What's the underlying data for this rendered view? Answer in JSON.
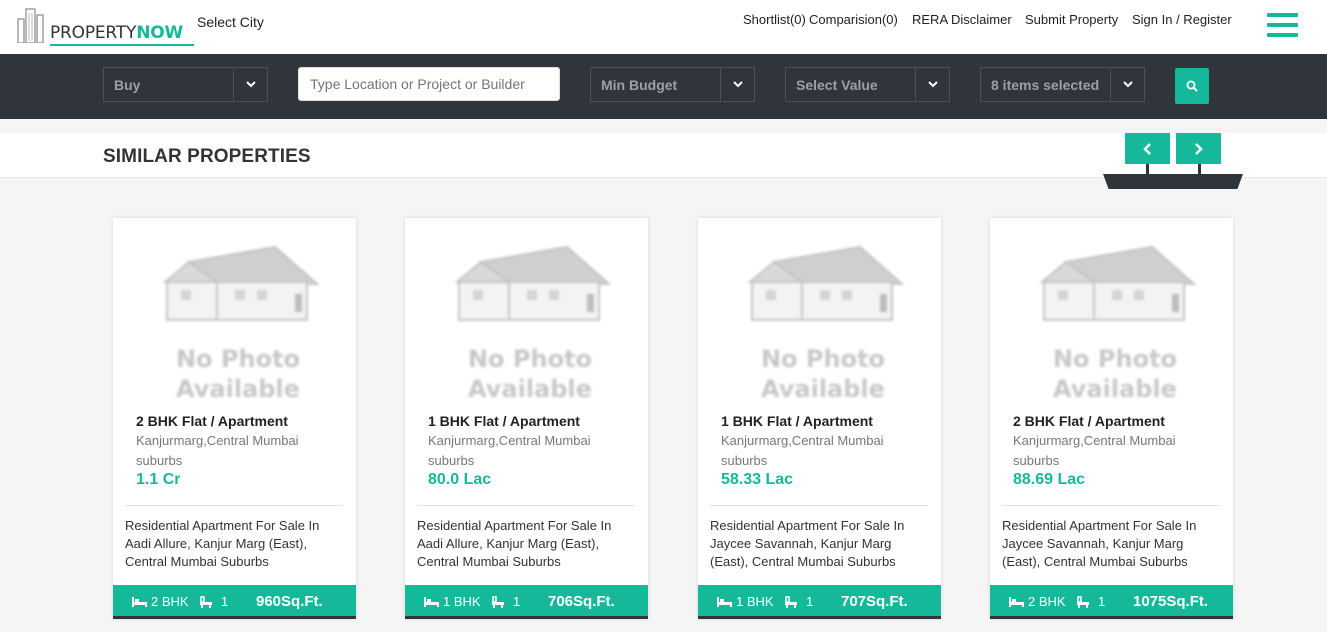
{
  "header": {
    "logo": {
      "part1": "PROPERTY",
      "part2": "NOW"
    },
    "select_city": "Select City",
    "nav": {
      "shortlist": "Shortlist(0)",
      "comparision": "Comparision(0)",
      "rera": "RERA Disclaimer",
      "submit": "Submit Property",
      "signin": "Sign In / Register"
    }
  },
  "search": {
    "type_value": "Buy",
    "location_placeholder": "Type Location or Project or Builder",
    "min_budget": "Min Budget",
    "max_value": "Select Value",
    "property_types": "8 items selected"
  },
  "section": {
    "title": "SIMILAR PROPERTIES"
  },
  "colors": {
    "accent": "#15b99a",
    "dark": "#2f353a"
  },
  "properties": [
    {
      "no_photo": "No Photo Available",
      "type": "2 BHK Flat / Apartment",
      "location": "Kanjurmarg,Central Mumbai suburbs",
      "price": "1.1 Cr",
      "description": "Residential Apartment For Sale In Aadi Allure, Kanjur Marg (East), Central Mumbai Suburbs",
      "beds": "2 BHK",
      "baths": "1",
      "area": "960Sq.Ft."
    },
    {
      "no_photo": "No Photo Available",
      "type": "1 BHK Flat / Apartment",
      "location": "Kanjurmarg,Central Mumbai suburbs",
      "price": "80.0 Lac",
      "description": "Residential Apartment For Sale In Aadi Allure, Kanjur Marg (East), Central Mumbai Suburbs",
      "beds": "1 BHK",
      "baths": "1",
      "area": "706Sq.Ft."
    },
    {
      "no_photo": "No Photo Available",
      "type": "1 BHK Flat / Apartment",
      "location": "Kanjurmarg,Central Mumbai suburbs",
      "price": "58.33 Lac",
      "description": "Residential Apartment For Sale In Jaycee Savannah, Kanjur Marg (East), Central Mumbai Suburbs",
      "beds": "1 BHK",
      "baths": "1",
      "area": "707Sq.Ft."
    },
    {
      "no_photo": "No Photo Available",
      "type": "2 BHK Flat / Apartment",
      "location": "Kanjurmarg,Central Mumbai suburbs",
      "price": "88.69 Lac",
      "description": "Residential Apartment For Sale In Jaycee Savannah, Kanjur Marg (East), Central Mumbai Suburbs",
      "beds": "2 BHK",
      "baths": "1",
      "area": "1075Sq.Ft."
    }
  ]
}
